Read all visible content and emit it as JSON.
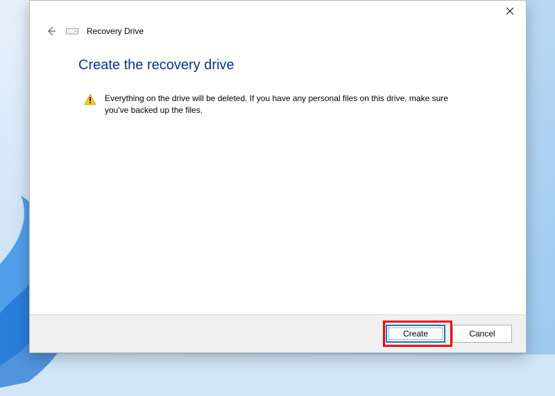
{
  "window": {
    "app_title": "Recovery Drive"
  },
  "content": {
    "heading": "Create the recovery drive",
    "warning_text": "Everything on the drive will be deleted. If you have any personal files on this drive, make sure you've backed up the files."
  },
  "footer": {
    "primary_label": "Create",
    "cancel_label": "Cancel"
  }
}
